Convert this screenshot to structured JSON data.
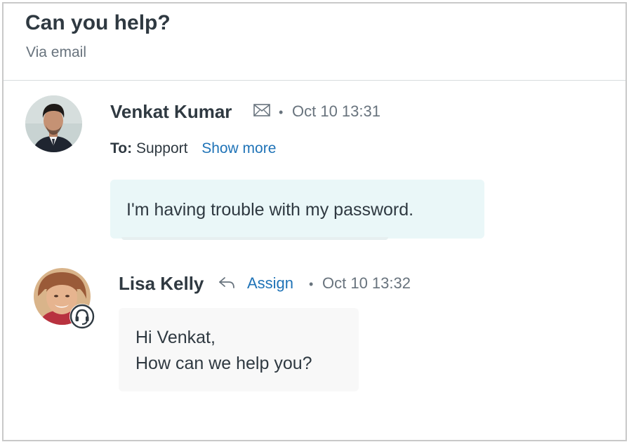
{
  "ticket": {
    "subject": "Can you help?",
    "channel": "Via email"
  },
  "messages": [
    {
      "author": "Venkat Kumar",
      "channel_icon": "envelope-icon",
      "separator": "•",
      "timestamp": "Oct 10 13:31",
      "to_label": "To:",
      "to_value": "Support",
      "show_more_label": "Show more",
      "body": "I'm having trouble with my password."
    },
    {
      "author": "Lisa Kelly",
      "channel_icon": "reply-arrow-icon",
      "assign_label": "Assign",
      "separator": "•",
      "timestamp": "Oct 10 13:32",
      "role_badge_icon": "headset-icon",
      "body_lines": [
        "Hi Venkat,",
        "How can we help you?"
      ]
    }
  ],
  "colors": {
    "link": "#1f73b7",
    "customer_bubble": "#eaf7f8",
    "agent_bubble": "#f8f8f8",
    "muted_text": "#68737d",
    "primary_text": "#2f3941"
  }
}
